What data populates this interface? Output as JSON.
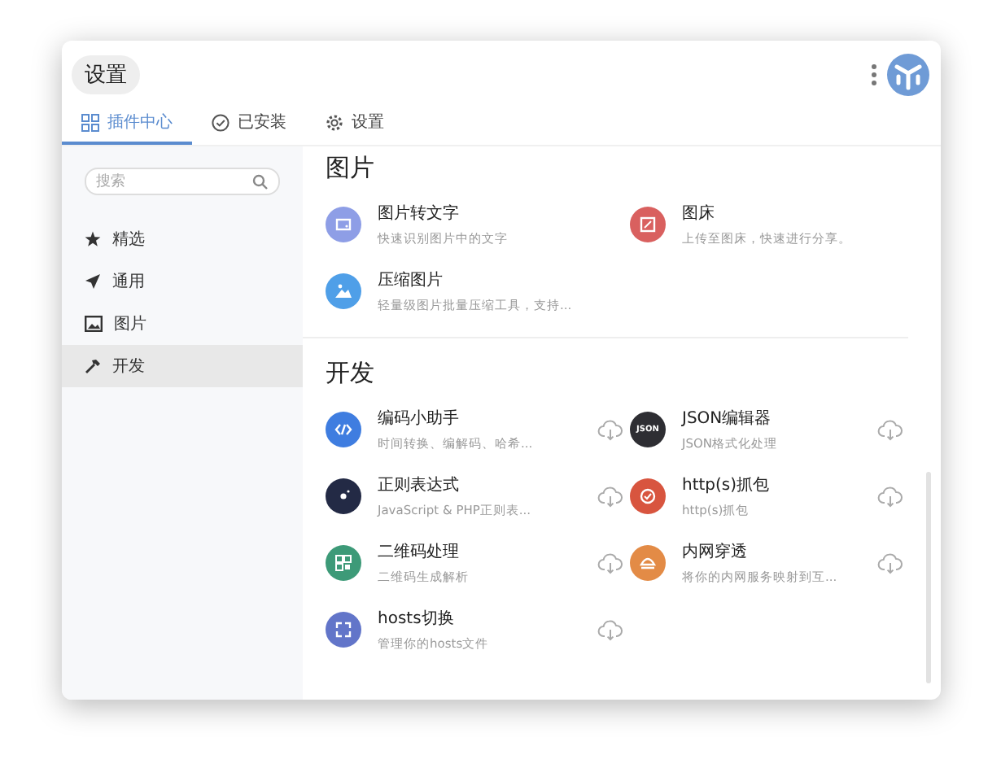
{
  "window": {
    "title": "设置"
  },
  "tabs": [
    {
      "label": "插件中心",
      "selected": true
    },
    {
      "label": "已安装",
      "selected": false
    },
    {
      "label": "设置",
      "selected": false
    }
  ],
  "sidebar": {
    "search": {
      "placeholder": "搜索"
    },
    "items": [
      {
        "label": "精选",
        "selected": false
      },
      {
        "label": "通用",
        "selected": false
      },
      {
        "label": "图片",
        "selected": false
      },
      {
        "label": "开发",
        "selected": true
      }
    ]
  },
  "sections": [
    {
      "title": "图片",
      "plugins": [
        {
          "name": "图片转文字",
          "description": "快速识别图片中的文字",
          "color": "#8e9ee6"
        },
        {
          "name": "图床",
          "description": "上传至图床，快速进行分享。",
          "color": "#d9605f"
        },
        {
          "name": "压缩图片",
          "description": "轻量级图片批量压缩工具，支持...",
          "color": "#4f9fe8"
        }
      ]
    },
    {
      "title": "开发",
      "plugins": [
        {
          "name": "编码小助手",
          "description": "时间转换、编解码、哈希...",
          "color": "#3f7de0",
          "download": true
        },
        {
          "name": "JSON编辑器",
          "description": "JSON格式化处理",
          "color": "#2e2e33",
          "download": true,
          "icon_label": "JSON"
        },
        {
          "name": "正则表达式",
          "description": "JavaScript & PHP正则表...",
          "color": "#232a45",
          "download": true
        },
        {
          "name": "http(s)抓包",
          "description": "http(s)抓包",
          "color": "#d8553f",
          "download": true
        },
        {
          "name": "二维码处理",
          "description": "二维码生成解析",
          "color": "#3d9a78",
          "download": true
        },
        {
          "name": "内网穿透",
          "description": "将你的内网服务映射到互...",
          "color": "#e38b46",
          "download": true
        },
        {
          "name": "hosts切换",
          "description": "管理你的hosts文件",
          "color": "#6275c9",
          "download": true
        }
      ]
    }
  ]
}
